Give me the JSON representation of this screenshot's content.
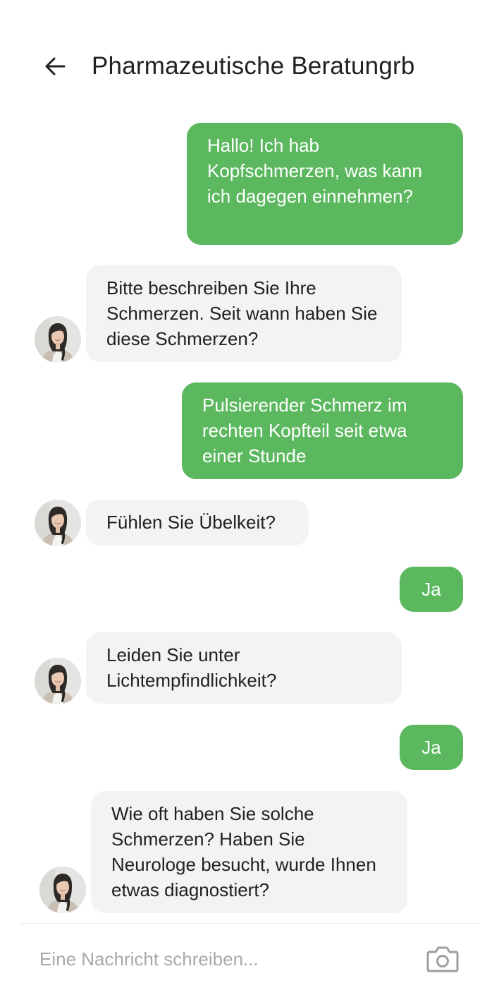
{
  "header": {
    "title": "Pharmazeutische Beratungrb",
    "back_icon": "arrow-left-icon"
  },
  "messages": [
    {
      "sender": "user",
      "text": "Hallo! Ich hab Kopfschmerzen, was kann ich dagegen einnehmen?"
    },
    {
      "sender": "pharmacist",
      "text": "Bitte beschreiben Sie Ihre Schmerzen. Seit wann haben Sie diese Schmerzen?"
    },
    {
      "sender": "user",
      "text": "Pulsierender Schmerz im rechten Kopfteil seit etwa einer Stunde"
    },
    {
      "sender": "pharmacist",
      "text": "Fühlen Sie Übelkeit?"
    },
    {
      "sender": "user",
      "text": "Ja"
    },
    {
      "sender": "pharmacist",
      "text": "Leiden Sie unter Lichtempfindlichkeit?"
    },
    {
      "sender": "user",
      "text": "Ja"
    },
    {
      "sender": "pharmacist",
      "text": "Wie oft haben Sie solche Schmerzen? Haben Sie Neurologe besucht, wurde Ihnen etwas diagnostiert?"
    }
  ],
  "composer": {
    "placeholder": "Eine Nachricht schreiben...",
    "camera_icon": "camera-icon"
  },
  "colors": {
    "outgoing_bubble": "#5cb85f",
    "incoming_bubble": "#f3f3f3",
    "text_primary": "#212121",
    "placeholder": "#a9a9a9"
  }
}
